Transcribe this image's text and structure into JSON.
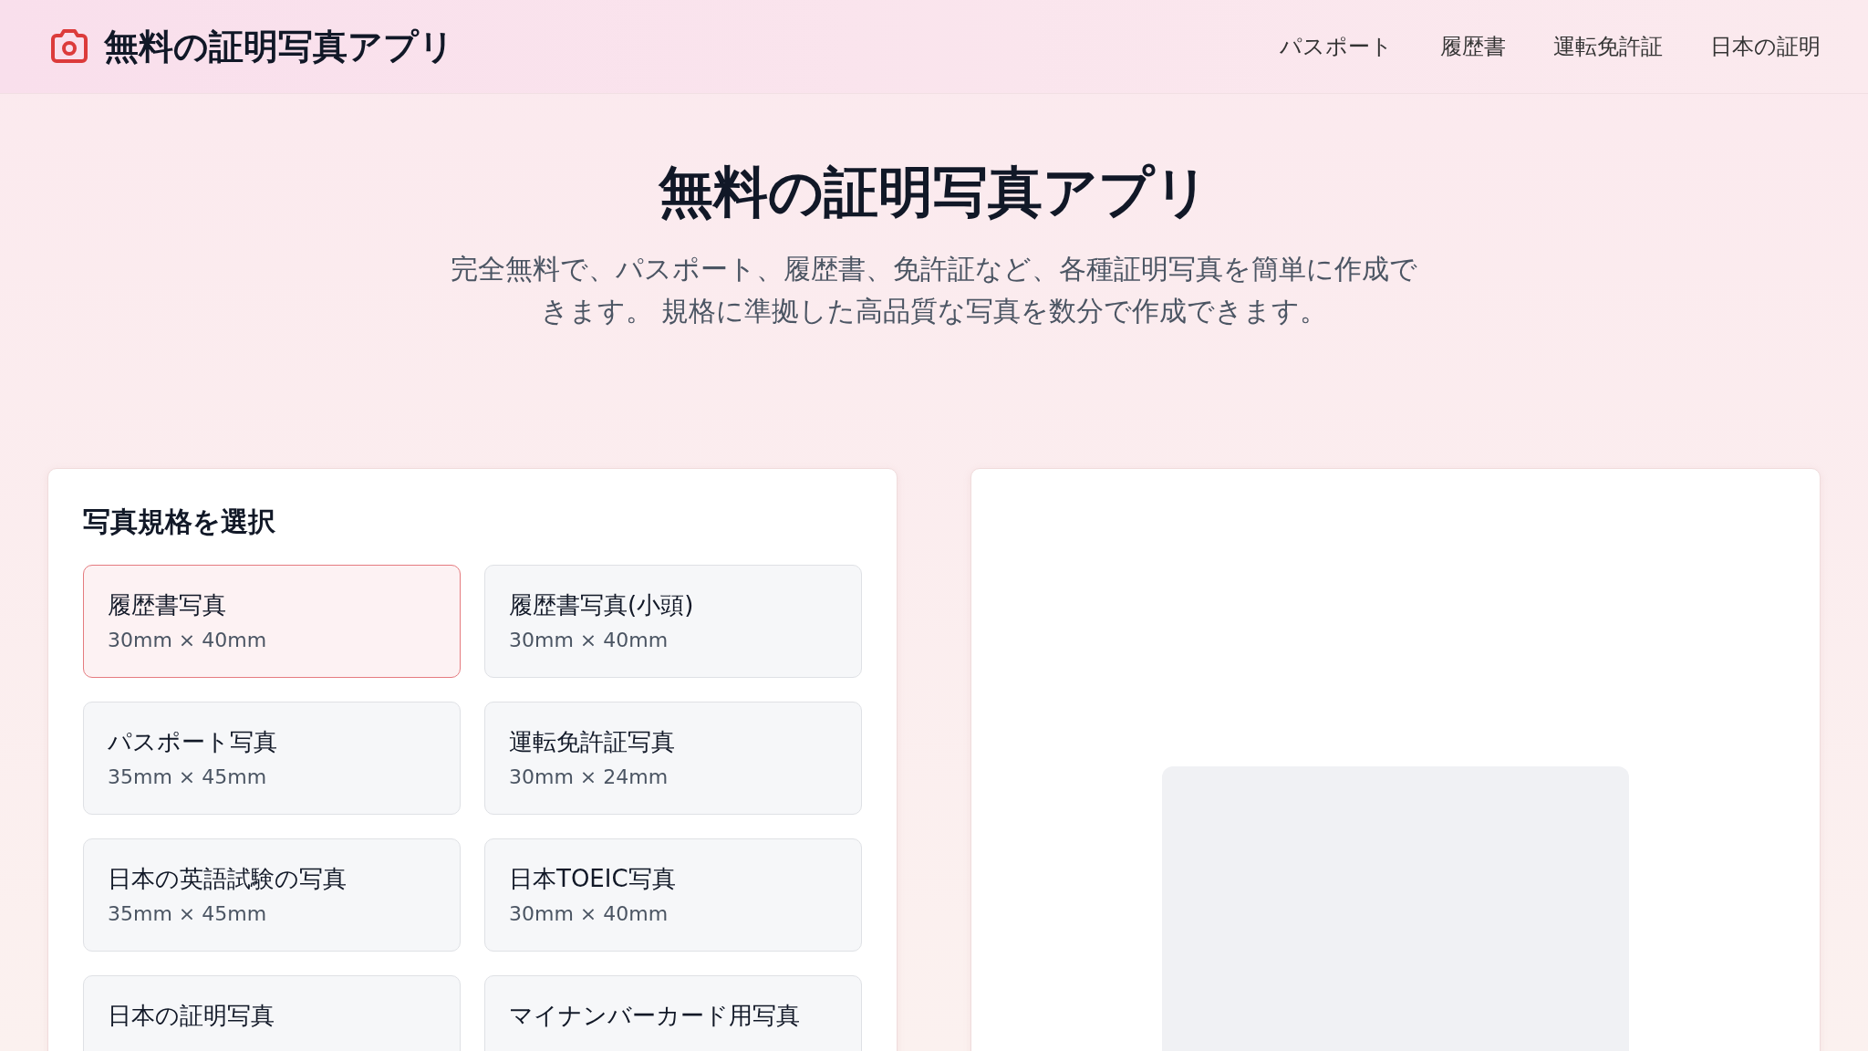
{
  "header": {
    "app_name": "無料の証明写真アプリ",
    "nav": [
      "パスポート",
      "履歴書",
      "運転免許証",
      "日本の証明"
    ]
  },
  "hero": {
    "title": "無料の証明写真アプリ",
    "subtitle": "完全無料で、パスポート、履歴書、免許証など、各種証明写真を簡単に作成できます。 規格に準拠した高品質な写真を数分で作成できます。"
  },
  "spec_panel": {
    "title": "写真規格を選択",
    "options": [
      {
        "name": "履歴書写真",
        "size": "30mm × 40mm",
        "selected": true
      },
      {
        "name": "履歴書写真(小頭)",
        "size": "30mm × 40mm",
        "selected": false
      },
      {
        "name": "パスポート写真",
        "size": "35mm × 45mm",
        "selected": false
      },
      {
        "name": "運転免許証写真",
        "size": "30mm × 24mm",
        "selected": false
      },
      {
        "name": "日本の英語試験の写真",
        "size": "35mm × 45mm",
        "selected": false
      },
      {
        "name": "日本TOEIC写真",
        "size": "30mm × 40mm",
        "selected": false
      },
      {
        "name": "日本の証明写真",
        "selected": false
      },
      {
        "name": "マイナンバーカード用写真",
        "selected": false
      }
    ]
  }
}
